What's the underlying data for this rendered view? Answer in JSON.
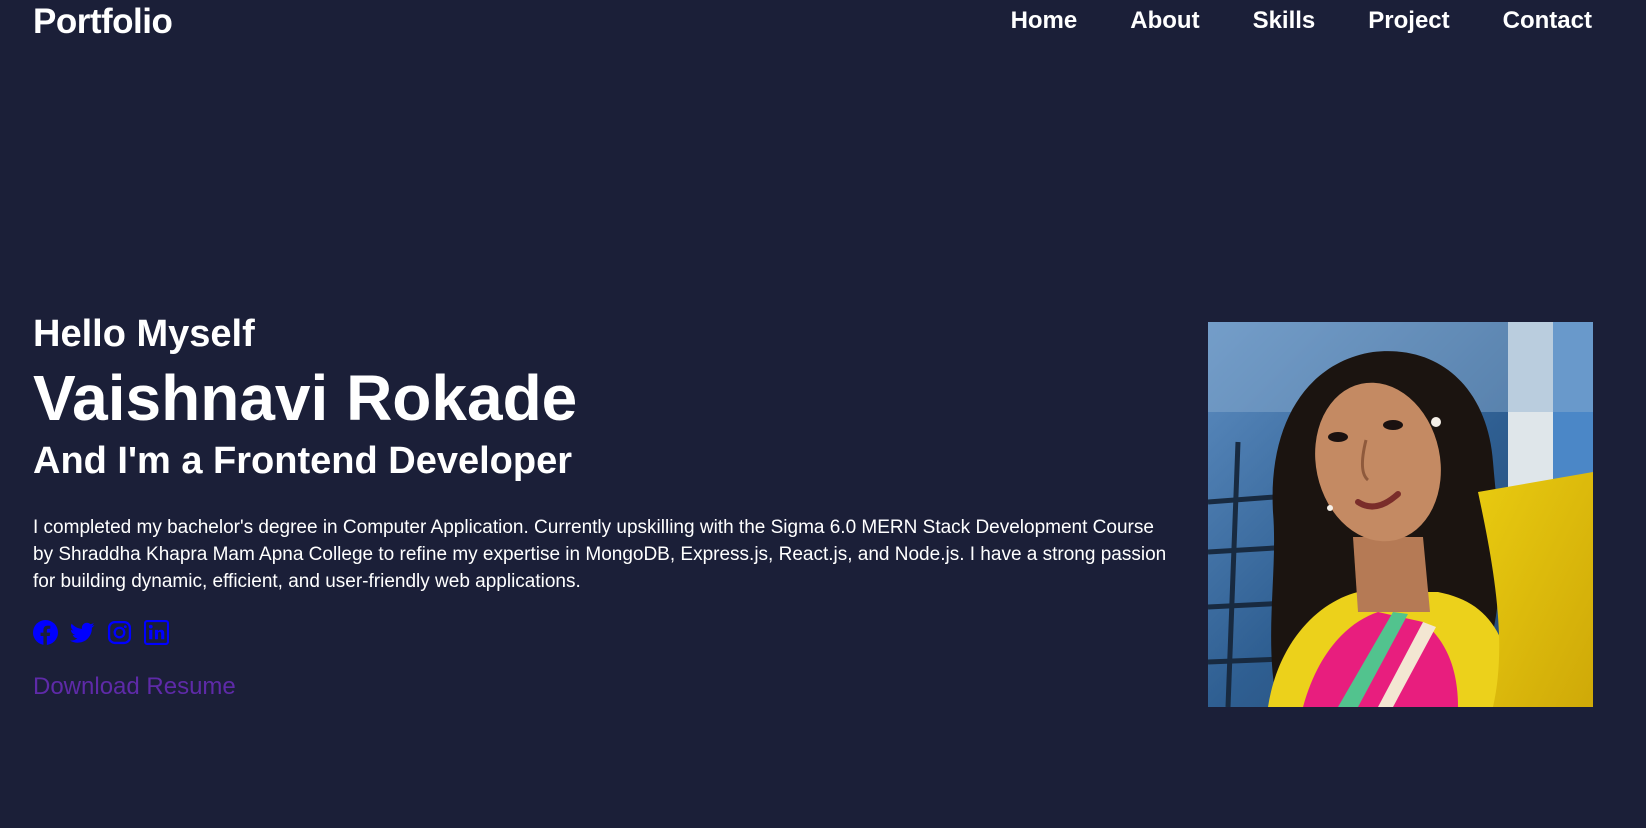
{
  "nav": {
    "brand": "Portfolio",
    "links": [
      "Home",
      "About",
      "Skills",
      "Project",
      "Contact"
    ]
  },
  "hero": {
    "greeting": "Hello Myself",
    "name": "Vaishnavi Rokade",
    "role": "And I'm a Frontend Developer",
    "bio": "I completed my bachelor's degree in Computer Application. Currently upskilling with the Sigma 6.0 MERN Stack Development Course by Shraddha Khapra Mam Apna College to refine my expertise in MongoDB, Express.js, React.js, and Node.js. I have a strong passion for building dynamic, efficient, and user-friendly web applications.",
    "resume_label": "Download Resume",
    "socials": [
      "facebook-icon",
      "twitter-icon",
      "instagram-icon",
      "linkedin-icon"
    ]
  },
  "colors": {
    "background": "#1b1f38",
    "text": "#ffffff",
    "social_icons": "#0000ff",
    "resume_link": "#5e2aa8"
  }
}
